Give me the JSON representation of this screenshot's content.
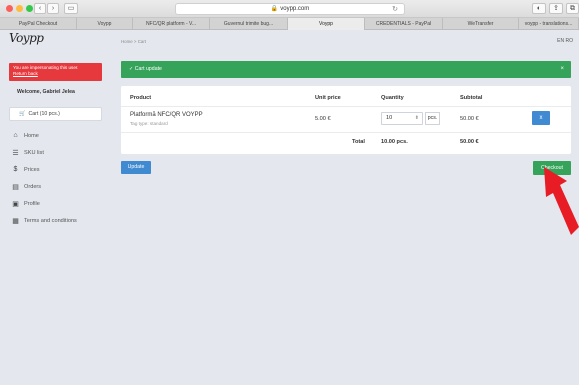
{
  "browser": {
    "url": "voypp.com",
    "tabs": [
      "PayPal Checkout",
      "Voypp",
      "NFC/QR platform - V...",
      "Guvernul trimite bug...",
      "Voypp",
      "CREDENTIALS - PayPal",
      "WeTransfer",
      "voypp - translations..."
    ],
    "active_tab_index": 4
  },
  "logo": "Voypp",
  "sidebar": {
    "impersonation_text": "You are impersonating this user.",
    "return_link": "Return back",
    "welcome": "Welcome, Gabriel Jelea",
    "cart_label": "Cart (10 pcs.)",
    "nav": [
      {
        "label": "Home",
        "icon": "home-icon"
      },
      {
        "label": "SKU list",
        "icon": "list-icon"
      },
      {
        "label": "Prices",
        "icon": "dollar-icon"
      },
      {
        "label": "Orders",
        "icon": "document-icon"
      },
      {
        "label": "Profile",
        "icon": "id-card-icon"
      },
      {
        "label": "Terms and conditions",
        "icon": "terms-icon"
      }
    ]
  },
  "breadcrumb": "Home > Cart",
  "flags": "EN RO",
  "alert": {
    "text": "Cart update",
    "close": "×"
  },
  "table": {
    "headers": {
      "product": "Product",
      "unit_price": "Unit price",
      "quantity": "Quantity",
      "subtotal": "Subtotal"
    },
    "rows": [
      {
        "product": "Platformă NFC/QR VOYPP",
        "tag_type": "Tag type: standard",
        "unit_price": "5.00 €",
        "quantity": "10",
        "unit": "pcs.",
        "subtotal": "50.00 €",
        "remove": "x"
      }
    ],
    "total_label": "Total",
    "total_qty": "10.00 pcs.",
    "total_value": "50.00 €"
  },
  "buttons": {
    "update": "Update",
    "checkout": "Checkout"
  },
  "colors": {
    "green": "#35a45a",
    "blue": "#3f8ad1",
    "red": "#e5393d"
  }
}
